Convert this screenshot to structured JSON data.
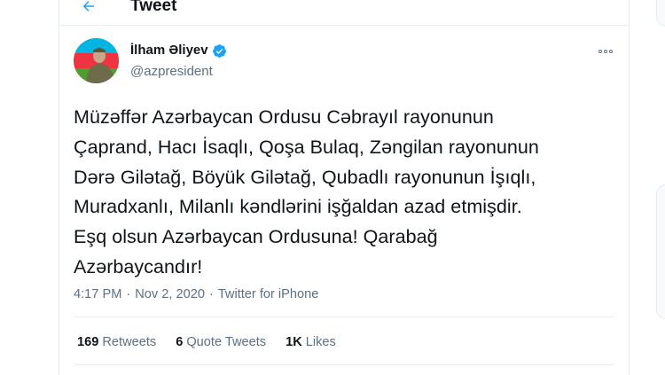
{
  "header": {
    "title": "Tweet"
  },
  "author": {
    "display_name": "İlham Əliyev",
    "handle": "@azpresident",
    "verified": true
  },
  "tweet": {
    "text": "Müzəffər Azərbaycan Ordusu Cəbrayıl rayonunun\nÇaprand, Hacı İsaqlı, Qoşa Bulaq, Zəngilan rayonunun\nDərə Gilətağ, Böyük Gilətağ, Qubadlı rayonunun İşıqlı,\nMuradxanlı, Milanlı kəndlərini işğaldan azad etmişdir.\nEşq olsun Azərbaycan Ordusuna! Qarabağ\nAzərbaycandır!",
    "time": "4:17 PM",
    "separator": "·",
    "date": "Nov 2, 2020",
    "source": "Twitter for iPhone"
  },
  "stats": {
    "retweets_count": "169",
    "retweets_label": "Retweets",
    "quotes_count": "6",
    "quotes_label": "Quote Tweets",
    "likes_count": "1K",
    "likes_label": "Likes"
  },
  "icons": {
    "back": "arrow-left-icon",
    "verified": "verified-badge-icon",
    "more": "more-options-icon"
  },
  "colors": {
    "accent": "#1da1f2",
    "text": "#0f1419",
    "secondary": "#5b7083",
    "border": "#e6ecf0"
  }
}
